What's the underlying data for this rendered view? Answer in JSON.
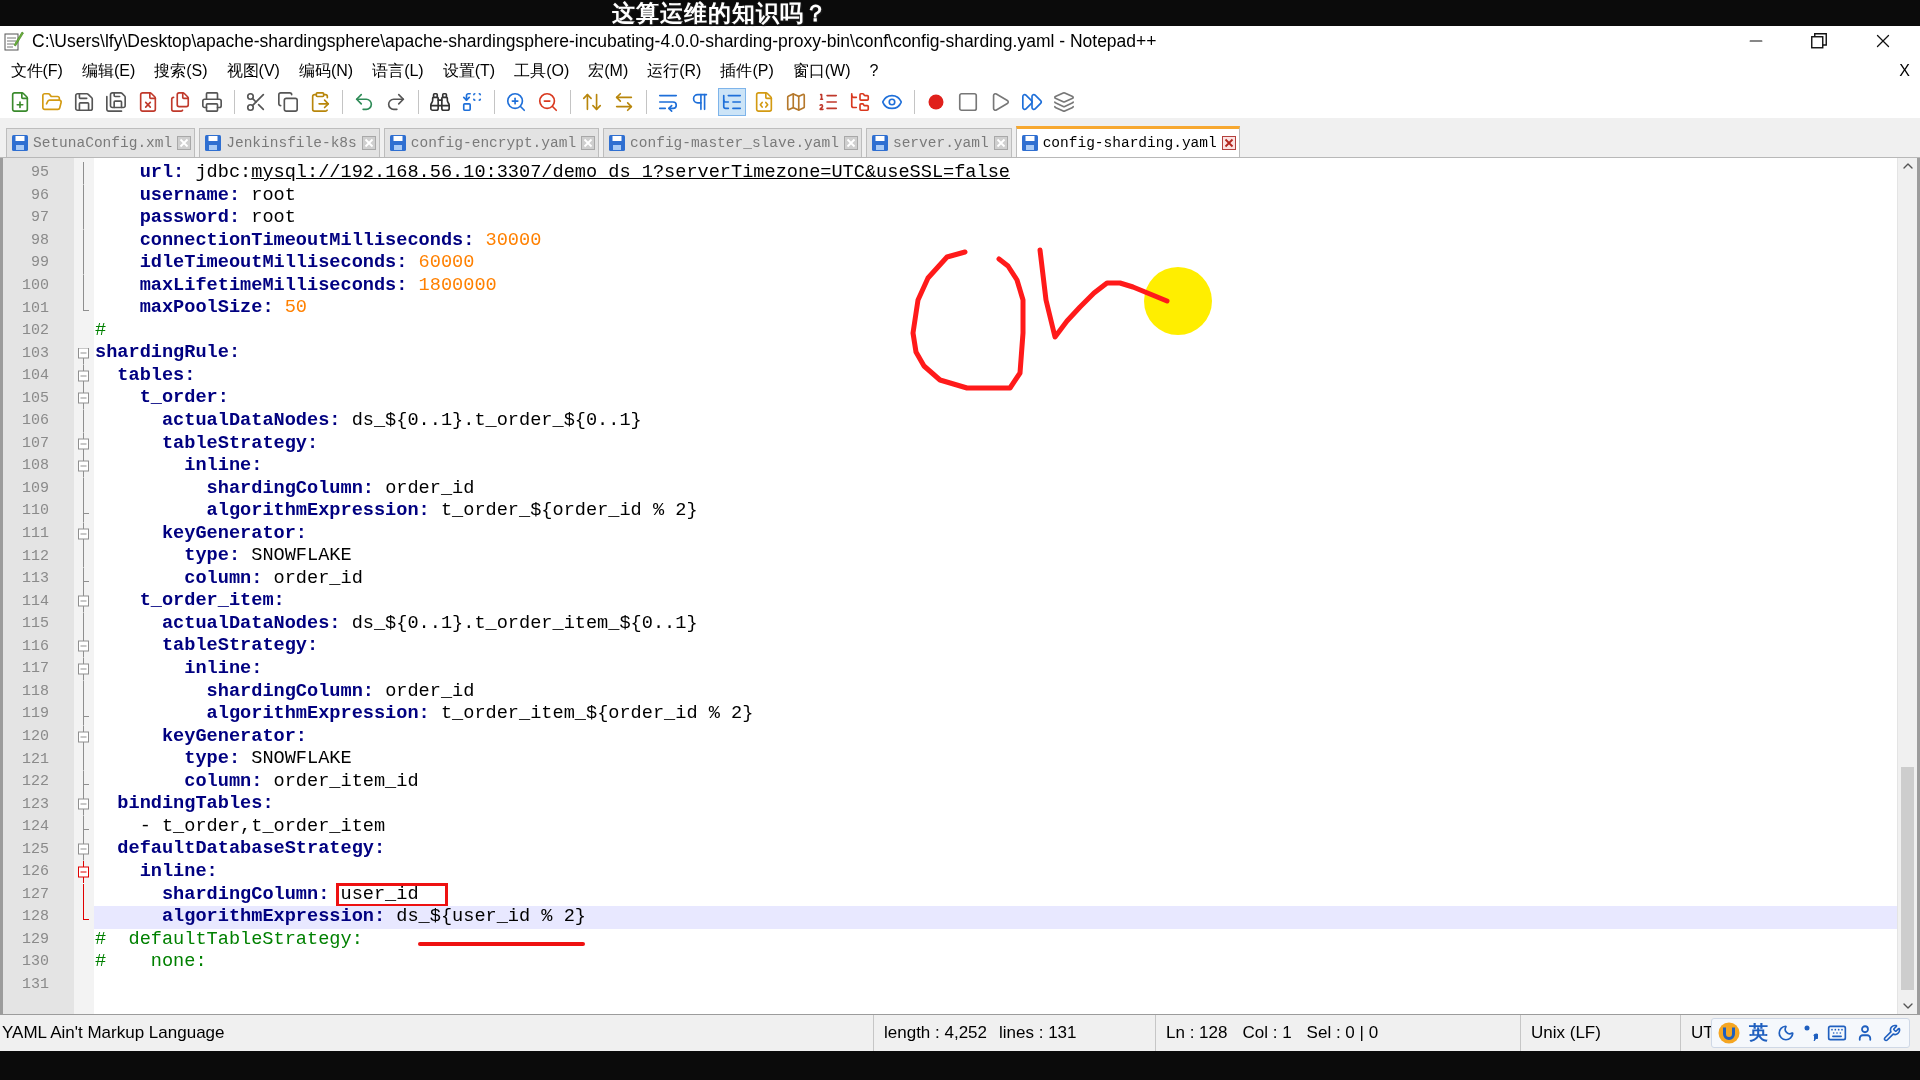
{
  "subtitle": "这算运维的知识吗？",
  "window": {
    "title": "C:\\Users\\lfy\\Desktop\\apache-shardingsphere\\apache-shardingsphere-incubating-4.0.0-sharding-proxy-bin\\conf\\config-sharding.yaml - Notepad++"
  },
  "menu": [
    "文件(F)",
    "编辑(E)",
    "搜索(S)",
    "视图(V)",
    "编码(N)",
    "语言(L)",
    "设置(T)",
    "工具(O)",
    "宏(M)",
    "运行(R)",
    "插件(P)",
    "窗口(W)",
    "?"
  ],
  "menu_close": "X",
  "toolbar": [
    {
      "kind": "new",
      "pressed": false
    },
    {
      "kind": "open",
      "pressed": false
    },
    {
      "kind": "save",
      "pressed": false
    },
    {
      "kind": "save_all",
      "pressed": false
    },
    {
      "kind": "close",
      "pressed": false
    },
    {
      "kind": "close_all",
      "pressed": false
    },
    {
      "kind": "print",
      "pressed": false
    },
    {
      "kind": "separator"
    },
    {
      "kind": "cut",
      "pressed": false
    },
    {
      "kind": "copy",
      "pressed": false
    },
    {
      "kind": "paste",
      "pressed": false
    },
    {
      "kind": "separator"
    },
    {
      "kind": "undo",
      "pressed": false
    },
    {
      "kind": "redo",
      "pressed": false
    },
    {
      "kind": "separator"
    },
    {
      "kind": "find",
      "pressed": false
    },
    {
      "kind": "replace",
      "pressed": false
    },
    {
      "kind": "separator"
    },
    {
      "kind": "zoom_in",
      "pressed": false
    },
    {
      "kind": "zoom_out",
      "pressed": false
    },
    {
      "kind": "separator"
    },
    {
      "kind": "sync_v",
      "pressed": false
    },
    {
      "kind": "sync_h",
      "pressed": false
    },
    {
      "kind": "separator"
    },
    {
      "kind": "wrap",
      "pressed": false
    },
    {
      "kind": "all_chars",
      "pressed": false
    },
    {
      "kind": "indent_guide",
      "pressed": true
    },
    {
      "kind": "udl",
      "pressed": false
    },
    {
      "kind": "doc_map",
      "pressed": false
    },
    {
      "kind": "function_list",
      "pressed": false
    },
    {
      "kind": "folder_workspace",
      "pressed": false
    },
    {
      "kind": "monitor",
      "pressed": false
    },
    {
      "kind": "separator"
    },
    {
      "kind": "record",
      "pressed": false
    },
    {
      "kind": "stop",
      "pressed": false
    },
    {
      "kind": "play",
      "pressed": false
    },
    {
      "kind": "play_multi",
      "pressed": false
    },
    {
      "kind": "save_macro",
      "pressed": false
    }
  ],
  "tabs": [
    {
      "label": "SetunaConfig.xml",
      "selected": false
    },
    {
      "label": "Jenkinsfile-k8s",
      "selected": false
    },
    {
      "label": "config-encrypt.yaml",
      "selected": false
    },
    {
      "label": "config-master_slave.yaml",
      "selected": false
    },
    {
      "label": "server.yaml",
      "selected": false
    },
    {
      "label": "config-sharding.yaml",
      "selected": true
    }
  ],
  "code_lines": [
    {
      "number": "95",
      "kind": "body",
      "current": false,
      "parts": [
        {
          "kind": "key",
          "text": "    url: "
        },
        {
          "kind": "plain",
          "text": "jdbc:"
        },
        {
          "kind": "link",
          "text": "mysql://192.168.56.10:3307/demo_ds_1?serverTimezone=UTC&useSSL=false"
        }
      ]
    },
    {
      "number": "96",
      "kind": "body",
      "current": false,
      "parts": [
        {
          "kind": "key",
          "text": "    username: "
        },
        {
          "kind": "plain",
          "text": "root"
        }
      ]
    },
    {
      "number": "97",
      "kind": "body",
      "current": false,
      "parts": [
        {
          "kind": "key",
          "text": "    password: "
        },
        {
          "kind": "plain",
          "text": "root"
        }
      ]
    },
    {
      "number": "98",
      "kind": "body",
      "current": false,
      "parts": [
        {
          "kind": "key",
          "text": "    connectionTimeoutMilliseconds: "
        },
        {
          "kind": "number",
          "text": "30000"
        }
      ]
    },
    {
      "number": "99",
      "kind": "body",
      "current": false,
      "parts": [
        {
          "kind": "key",
          "text": "    idleTimeoutMilliseconds: "
        },
        {
          "kind": "number",
          "text": "60000"
        }
      ]
    },
    {
      "number": "100",
      "kind": "body",
      "current": false,
      "parts": [
        {
          "kind": "key",
          "text": "    maxLifetimeMilliseconds: "
        },
        {
          "kind": "number",
          "text": "1800000"
        }
      ]
    },
    {
      "number": "101",
      "kind": "tail",
      "current": false,
      "parts": [
        {
          "kind": "key",
          "text": "    maxPoolSize: "
        },
        {
          "kind": "number",
          "text": "50"
        }
      ]
    },
    {
      "number": "102",
      "kind": "plain",
      "current": false,
      "parts": [
        {
          "kind": "comment",
          "text": "#"
        }
      ]
    },
    {
      "number": "103",
      "kind": "head",
      "current": false,
      "parts": [
        {
          "kind": "key",
          "text": "shardingRule:"
        }
      ]
    },
    {
      "number": "104",
      "kind": "head",
      "current": false,
      "parts": [
        {
          "kind": "key",
          "text": "  tables:"
        }
      ]
    },
    {
      "number": "105",
      "kind": "head",
      "current": false,
      "parts": [
        {
          "kind": "key",
          "text": "    t_order:"
        }
      ]
    },
    {
      "number": "106",
      "kind": "body",
      "current": false,
      "parts": [
        {
          "kind": "key",
          "text": "      actualDataNodes: "
        },
        {
          "kind": "plain",
          "text": "ds_${0..1}.t_order_${0..1}"
        }
      ]
    },
    {
      "number": "107",
      "kind": "head",
      "current": false,
      "parts": [
        {
          "kind": "key",
          "text": "      tableStrategy:"
        }
      ]
    },
    {
      "number": "108",
      "kind": "head",
      "current": false,
      "parts": [
        {
          "kind": "key",
          "text": "        inline:"
        }
      ]
    },
    {
      "number": "109",
      "kind": "body",
      "current": false,
      "parts": [
        {
          "kind": "key",
          "text": "          shardingColumn: "
        },
        {
          "kind": "plain",
          "text": "order_id"
        }
      ]
    },
    {
      "number": "110",
      "kind": "branch",
      "current": false,
      "parts": [
        {
          "kind": "key",
          "text": "          algorithmExpression: "
        },
        {
          "kind": "plain",
          "text": "t_order_${order_id % 2}"
        }
      ]
    },
    {
      "number": "111",
      "kind": "head",
      "current": false,
      "parts": [
        {
          "kind": "key",
          "text": "      keyGenerator:"
        }
      ]
    },
    {
      "number": "112",
      "kind": "body",
      "current": false,
      "parts": [
        {
          "kind": "key",
          "text": "        type: "
        },
        {
          "kind": "plain",
          "text": "SNOWFLAKE"
        }
      ]
    },
    {
      "number": "113",
      "kind": "branch",
      "current": false,
      "parts": [
        {
          "kind": "key",
          "text": "        column: "
        },
        {
          "kind": "plain",
          "text": "order_id"
        }
      ]
    },
    {
      "number": "114",
      "kind": "head",
      "current": false,
      "parts": [
        {
          "kind": "key",
          "text": "    t_order_item:"
        }
      ]
    },
    {
      "number": "115",
      "kind": "body",
      "current": false,
      "parts": [
        {
          "kind": "key",
          "text": "      actualDataNodes: "
        },
        {
          "kind": "plain",
          "text": "ds_${0..1}.t_order_item_${0..1}"
        }
      ]
    },
    {
      "number": "116",
      "kind": "head",
      "current": false,
      "parts": [
        {
          "kind": "key",
          "text": "      tableStrategy:"
        }
      ]
    },
    {
      "number": "117",
      "kind": "head",
      "current": false,
      "parts": [
        {
          "kind": "key",
          "text": "        inline:"
        }
      ]
    },
    {
      "number": "118",
      "kind": "body",
      "current": false,
      "parts": [
        {
          "kind": "key",
          "text": "          shardingColumn: "
        },
        {
          "kind": "plain",
          "text": "order_id"
        }
      ]
    },
    {
      "number": "119",
      "kind": "branch",
      "current": false,
      "parts": [
        {
          "kind": "key",
          "text": "          algorithmExpression: "
        },
        {
          "kind": "plain",
          "text": "t_order_item_${order_id % 2}"
        }
      ]
    },
    {
      "number": "120",
      "kind": "head",
      "current": false,
      "parts": [
        {
          "kind": "key",
          "text": "      keyGenerator:"
        }
      ]
    },
    {
      "number": "121",
      "kind": "body",
      "current": false,
      "parts": [
        {
          "kind": "key",
          "text": "        type: "
        },
        {
          "kind": "plain",
          "text": "SNOWFLAKE"
        }
      ]
    },
    {
      "number": "122",
      "kind": "branch",
      "current": false,
      "parts": [
        {
          "kind": "key",
          "text": "        column: "
        },
        {
          "kind": "plain",
          "text": "order_item_id"
        }
      ]
    },
    {
      "number": "123",
      "kind": "head",
      "current": false,
      "parts": [
        {
          "kind": "key",
          "text": "  bindingTables:"
        }
      ]
    },
    {
      "number": "124",
      "kind": "branch",
      "current": false,
      "parts": [
        {
          "kind": "plain",
          "text": "    - t_order,t_order_item"
        }
      ]
    },
    {
      "number": "125",
      "kind": "head",
      "current": false,
      "parts": [
        {
          "kind": "key",
          "text": "  defaultDatabaseStrategy:"
        }
      ]
    },
    {
      "number": "126",
      "kind": "active_head",
      "current": false,
      "parts": [
        {
          "kind": "key",
          "text": "    inline:"
        }
      ]
    },
    {
      "number": "127",
      "kind": "active_body",
      "current": false,
      "parts": [
        {
          "kind": "key",
          "text": "      shardingColumn: "
        },
        {
          "kind": "plain",
          "text": "user_id",
          "annotation": {
            "kind": "box"
          }
        }
      ]
    },
    {
      "number": "128",
      "kind": "active_tail",
      "current": true,
      "parts": [
        {
          "kind": "key",
          "text": "      algorithmExpression: "
        },
        {
          "kind": "plain",
          "text": "ds_${user_id % 2}",
          "annotation": {
            "kind": "underline"
          }
        }
      ]
    },
    {
      "number": "129",
      "kind": "plain",
      "current": false,
      "parts": [
        {
          "kind": "comment",
          "text": "#  defaultTableStrategy:"
        }
      ]
    },
    {
      "number": "130",
      "kind": "plain",
      "current": false,
      "parts": [
        {
          "kind": "comment",
          "text": "#    none:"
        }
      ]
    },
    {
      "number": "131",
      "kind": "plain",
      "current": false
    }
  ],
  "annotations": [
    {
      "kind": "cursor_dot"
    },
    {
      "kind": "ok_scribble"
    }
  ],
  "status_bar": {
    "language": "YAML Ain't Markup Language",
    "length": "length : 4,252",
    "lines": "lines : 131",
    "ln": "Ln : 128",
    "col": "Col : 1",
    "sel": "Sel : 0 | 0",
    "eol": "Unix (LF)",
    "encoding": "UT"
  },
  "ime_bar": {
    "mode": "英"
  }
}
